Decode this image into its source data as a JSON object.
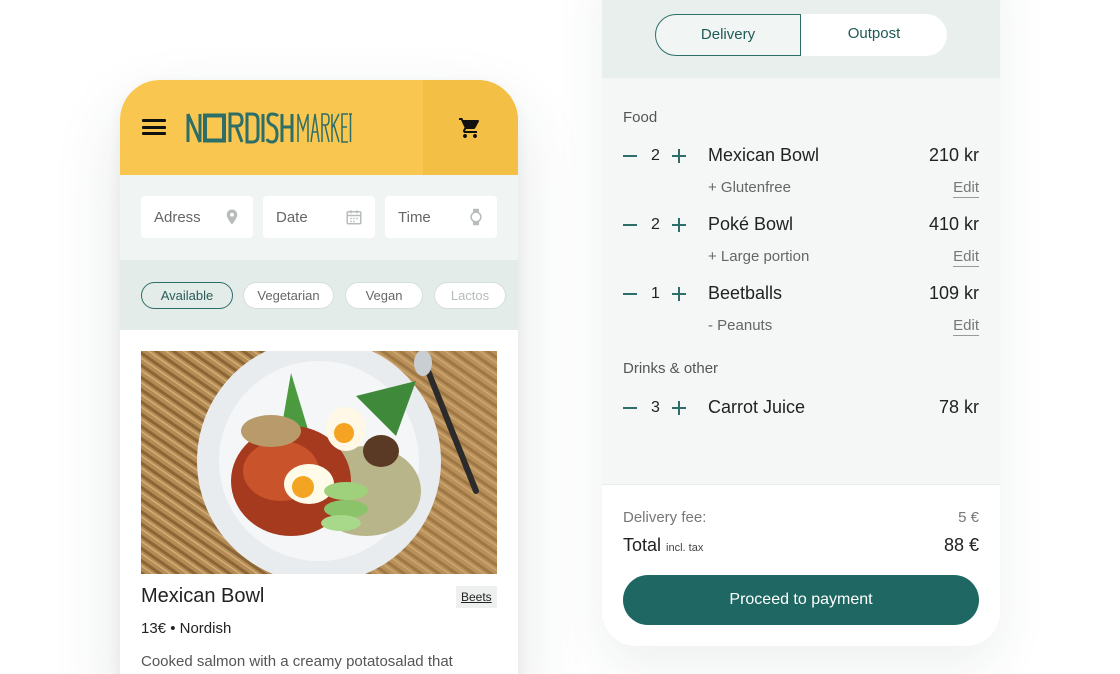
{
  "app": {
    "brand": "NORDISHMARKET",
    "brand_color": "#2e6e68",
    "accent_color": "#f9c74f"
  },
  "header": {
    "menu_icon": "hamburger-menu-icon",
    "cart_icon": "shopping-cart-icon"
  },
  "search": {
    "address_placeholder": "Adress",
    "date_placeholder": "Date",
    "time_placeholder": "Time"
  },
  "filters": [
    {
      "label": "Available",
      "active": true
    },
    {
      "label": "Vegetarian",
      "active": false
    },
    {
      "label": "Vegan",
      "active": false
    },
    {
      "label": "Lactos",
      "active": false
    }
  ],
  "product": {
    "name": "Mexican Bowl",
    "tag": "Beets",
    "meta": "13€ • Nordish",
    "description": "Cooked salmon with a creamy potatosalad that"
  },
  "cart": {
    "tabs": [
      "Delivery",
      "Outpost"
    ],
    "active_tab": "Delivery",
    "sections": [
      {
        "label": "Food",
        "items": [
          {
            "qty": "2",
            "name": "Mexican Bowl",
            "price": "210 kr",
            "option": "+ Glutenfree",
            "edit_label": "Edit"
          },
          {
            "qty": "2",
            "name": "Poké Bowl",
            "price": "410 kr",
            "option": "+ Large portion",
            "edit_label": "Edit"
          },
          {
            "qty": "1",
            "name": "Beetballs",
            "price": "109 kr",
            "option": "- Peanuts",
            "edit_label": "Edit"
          }
        ]
      },
      {
        "label": "Drinks & other",
        "items": [
          {
            "qty": "3",
            "name": "Carrot Juice",
            "price": "78 kr"
          }
        ]
      }
    ],
    "delivery_fee_label": "Delivery fee:",
    "delivery_fee": "5 €",
    "total_label": "Total",
    "total_note": "incl. tax",
    "total": "88 €",
    "pay_label": "Proceed to payment"
  }
}
